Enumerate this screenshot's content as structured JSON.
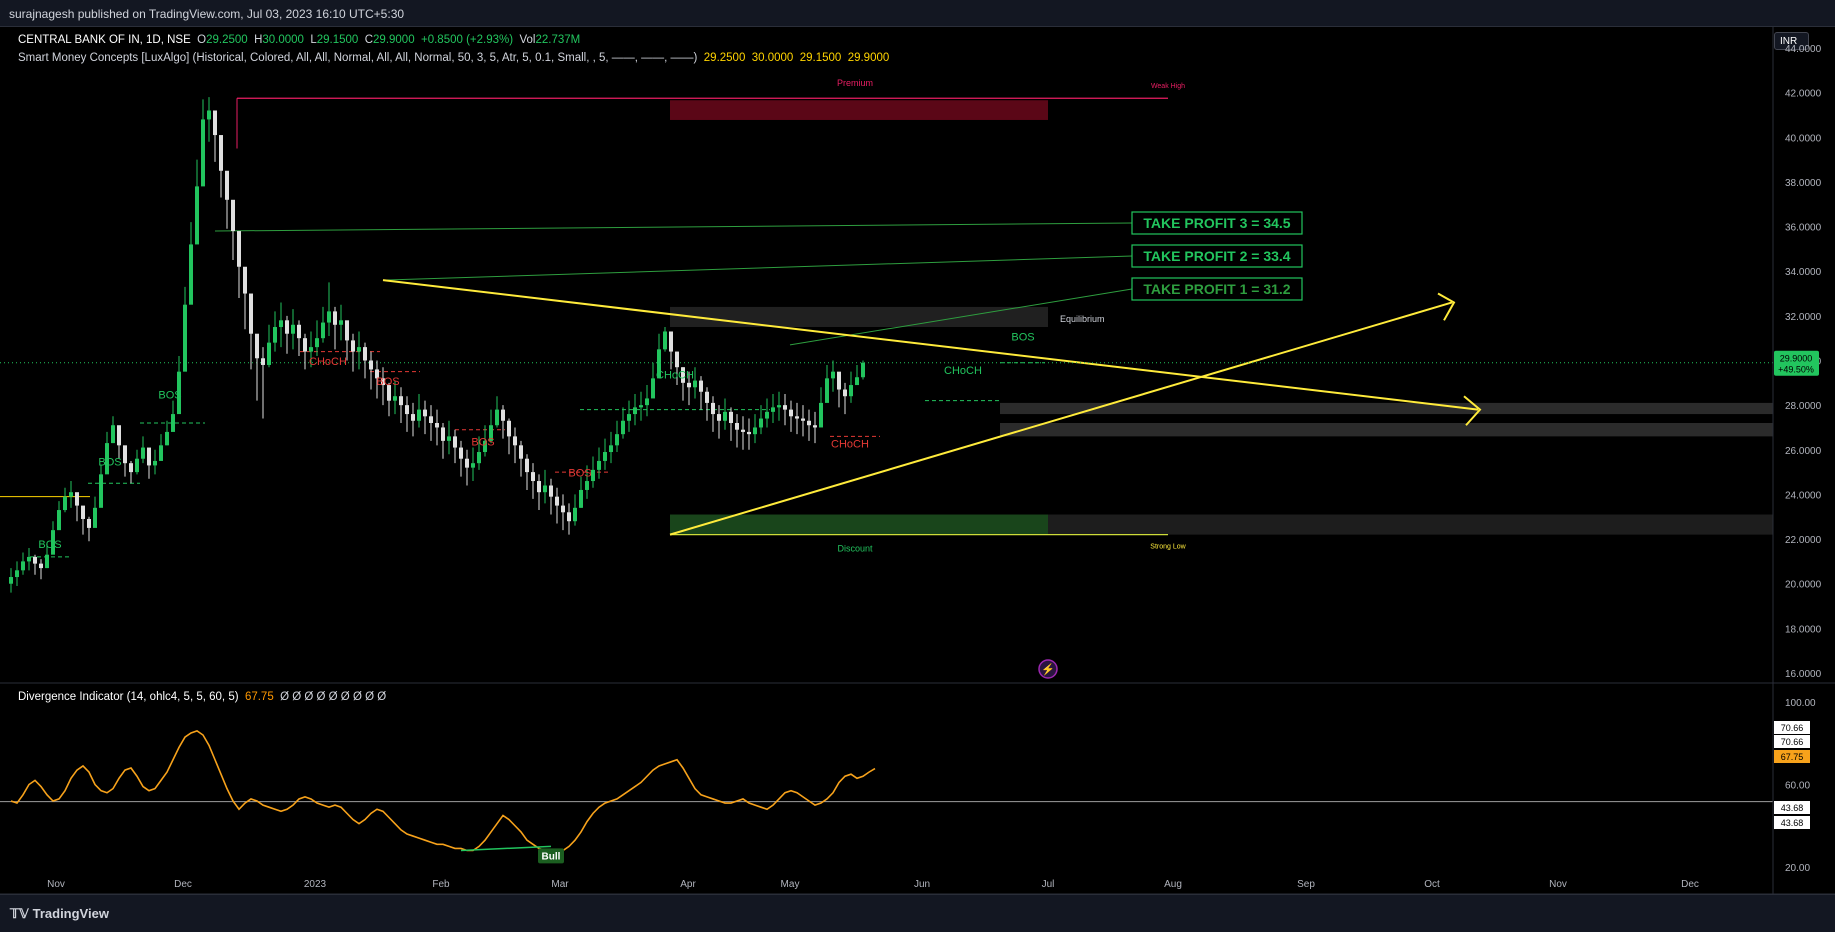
{
  "header": {
    "publisher_line": "surajnagesh published on TradingView.com, Jul 03, 2023 16:10 UTC+5:30"
  },
  "footer": {
    "brand": "TradingView"
  },
  "currency_button": "INR",
  "legend": {
    "symbol": "CENTRAL BANK OF IN, 1D, NSE",
    "o_label": "O",
    "o_value": "29.2500",
    "h_label": "H",
    "h_value": "30.0000",
    "l_label": "L",
    "l_value": "29.1500",
    "c_label": "C",
    "c_value": "29.9000",
    "change": "+0.8500 (+2.93%)",
    "vol_label": "Vol",
    "vol_value": "22.737M",
    "indicator": "Smart Money Concepts [LuxAlgo] (Historical, Colored, All, All, Normal, All, All, Normal, 50, 3, 5, Atr, 5, 0.1, Small, , 5, ——, ——, ——)",
    "indicator_values": [
      "29.2500",
      "30.0000",
      "29.1500",
      "29.9000"
    ]
  },
  "osc_legend": {
    "name": "Divergence Indicator (14, ohlc4, 5, 5, 60, 5)",
    "value": "67.75",
    "empties": "Ø Ø Ø Ø Ø Ø Ø Ø Ø"
  },
  "colors": {
    "up": "#22c55e",
    "down": "#e0e0e0",
    "bos_green": "#22c55e",
    "bos_red": "#e53935",
    "trend_yellow": "#ffeb3b",
    "osc_line": "#f7a21b",
    "premium": "#e91e63"
  },
  "chart_data": [
    {
      "type": "candlestick",
      "title": "CENTRAL BANK OF IN, 1D, NSE",
      "y_ticks": [
        "16.0000",
        "18.0000",
        "20.0000",
        "22.0000",
        "24.0000",
        "26.0000",
        "28.0000",
        "30.0000",
        "32.0000",
        "34.0000",
        "36.0000",
        "38.0000",
        "40.0000",
        "42.0000",
        "44.0000"
      ],
      "ylim": [
        15.3,
        45.2
      ],
      "x_ticks": [
        "Nov",
        "Dec",
        "2023",
        "Feb",
        "Mar",
        "Apr",
        "May",
        "Jun",
        "Jul",
        "Aug",
        "Sep",
        "Oct",
        "Nov",
        "Dec"
      ],
      "last_price": "29.9000",
      "last_change_pct": "+49.50%",
      "zones": {
        "premium_label": "Premium",
        "weak_high_label": "Weak High",
        "equilibrium_label": "Equilibrium",
        "discount_label": "Discount",
        "strong_low_label": "Strong Low",
        "weak_high": 41.75,
        "strong_low": 22.2
      },
      "take_profits": [
        "TAKE PROFIT 3 = 34.5",
        "TAKE PROFIT 2 = 33.4",
        "TAKE PROFIT 1 = 31.2"
      ],
      "structure_labels": [
        {
          "text": "BOS",
          "color": "green"
        },
        {
          "text": "BOS",
          "color": "green"
        },
        {
          "text": "BOS",
          "color": "green"
        },
        {
          "text": "CHoCH",
          "color": "red"
        },
        {
          "text": "BOS",
          "color": "red"
        },
        {
          "text": "BOS",
          "color": "red"
        },
        {
          "text": "BOS",
          "color": "red"
        },
        {
          "text": "CHoCH",
          "color": "green"
        },
        {
          "text": "CHoCH",
          "color": "red"
        },
        {
          "text": "CHoCH",
          "color": "green"
        },
        {
          "text": "BOS",
          "color": "green"
        }
      ],
      "close_series": [
        20.3,
        20.6,
        21.0,
        21.2,
        20.9,
        20.7,
        21.3,
        22.4,
        23.3,
        23.9,
        24.1,
        23.5,
        22.9,
        22.5,
        23.4,
        24.9,
        26.3,
        27.1,
        26.2,
        25.4,
        25.0,
        25.6,
        26.1,
        25.3,
        25.5,
        26.2,
        26.8,
        27.6,
        29.5,
        32.5,
        35.2,
        37.8,
        40.8,
        41.2,
        40.1,
        38.5,
        37.2,
        35.8,
        34.2,
        33.0,
        31.2,
        30.1,
        29.8,
        30.8,
        31.5,
        31.8,
        31.2,
        31.6,
        31.0,
        30.4,
        30.6,
        31.0,
        31.7,
        32.2,
        31.6,
        31.8,
        30.9,
        30.4,
        30.6,
        30.0,
        29.6,
        29.2,
        28.9,
        28.2,
        28.4,
        28.0,
        27.6,
        27.3,
        27.8,
        27.5,
        27.2,
        27.0,
        26.4,
        26.6,
        26.1,
        25.6,
        25.2,
        25.4,
        25.9,
        26.4,
        27.1,
        27.8,
        27.3,
        26.6,
        26.2,
        25.6,
        25.0,
        24.6,
        24.1,
        24.4,
        23.9,
        23.5,
        23.2,
        22.8,
        23.4,
        24.2,
        24.6,
        25.1,
        25.5,
        25.9,
        26.2,
        26.7,
        27.3,
        27.6,
        27.9,
        28.0,
        28.3,
        29.2,
        30.5,
        31.3,
        30.4,
        29.7,
        29.0,
        28.8,
        29.1,
        28.6,
        28.1,
        27.6,
        27.3,
        27.7,
        27.2,
        26.9,
        26.8,
        26.7,
        27.0,
        27.4,
        27.7,
        27.9,
        28.0,
        27.8,
        27.5,
        27.4,
        27.3,
        27.1,
        27.0,
        28.1,
        29.2,
        29.5,
        28.7,
        28.4,
        28.9,
        29.25,
        29.9
      ],
      "high_series": [
        20.7,
        21.0,
        21.4,
        21.6,
        21.3,
        21.1,
        21.8,
        22.8,
        23.7,
        24.3,
        24.6,
        24.0,
        23.4,
        23.0,
        23.9,
        25.3,
        26.8,
        27.5,
        26.7,
        25.9,
        25.5,
        26.0,
        26.6,
        25.8,
        26.0,
        26.7,
        27.3,
        28.2,
        30.2,
        33.3,
        36.2,
        39.0,
        41.7,
        41.8,
        41.0,
        39.4,
        38.0,
        36.6,
        35.0,
        33.8,
        32.0,
        30.9,
        30.6,
        31.6,
        32.2,
        32.6,
        32.0,
        32.3,
        31.8,
        31.2,
        31.3,
        31.8,
        32.4,
        33.5,
        32.4,
        32.5,
        31.7,
        31.2,
        31.3,
        30.8,
        30.4,
        30.0,
        29.7,
        29.0,
        29.1,
        28.8,
        28.4,
        28.1,
        28.5,
        28.2,
        28.0,
        27.8,
        27.2,
        27.3,
        26.9,
        26.4,
        26.0,
        26.1,
        26.6,
        27.1,
        27.8,
        28.4,
        28.0,
        27.4,
        27.0,
        26.4,
        25.8,
        25.4,
        24.9,
        25.1,
        24.7,
        24.3,
        24.0,
        23.6,
        24.0,
        24.8,
        25.3,
        25.7,
        26.1,
        26.5,
        26.8,
        27.3,
        27.9,
        28.2,
        28.5,
        28.6,
        28.9,
        29.9,
        31.2,
        31.5,
        31.0,
        30.4,
        29.7,
        29.5,
        29.7,
        29.3,
        28.8,
        28.4,
        28.0,
        28.3,
        27.9,
        27.6,
        27.5,
        27.4,
        27.6,
        28.0,
        28.3,
        28.5,
        28.6,
        28.5,
        28.2,
        28.1,
        28.0,
        27.8,
        27.7,
        28.8,
        29.8,
        30.0,
        29.4,
        29.0,
        29.5,
        29.8,
        30.0
      ],
      "low_series": [
        19.6,
        19.9,
        20.4,
        20.6,
        20.4,
        20.2,
        20.7,
        21.7,
        22.6,
        23.2,
        23.4,
        22.8,
        22.2,
        21.9,
        22.7,
        24.2,
        25.6,
        26.3,
        25.6,
        24.8,
        24.5,
        24.9,
        25.4,
        24.7,
        24.9,
        25.6,
        26.2,
        26.9,
        28.6,
        31.1,
        33.5,
        36.1,
        38.9,
        39.8,
        38.9,
        37.3,
        35.9,
        34.5,
        32.8,
        31.4,
        29.6,
        28.2,
        27.4,
        29.7,
        30.4,
        30.6,
        30.3,
        30.5,
        30.2,
        29.6,
        29.7,
        30.2,
        30.8,
        31.1,
        30.5,
        30.9,
        30.0,
        29.5,
        29.6,
        29.2,
        28.7,
        28.3,
        28.0,
        27.5,
        27.6,
        27.2,
        26.8,
        26.6,
        27.0,
        26.7,
        26.4,
        26.2,
        25.6,
        25.8,
        25.4,
        24.8,
        24.4,
        24.6,
        25.1,
        25.7,
        26.3,
        27.0,
        26.5,
        25.8,
        25.4,
        24.8,
        24.2,
        23.8,
        23.3,
        23.6,
        23.1,
        22.7,
        22.4,
        22.2,
        22.6,
        23.4,
        23.8,
        24.3,
        24.7,
        25.1,
        25.4,
        25.9,
        26.5,
        26.8,
        27.1,
        27.3,
        27.5,
        28.4,
        29.6,
        30.4,
        29.6,
        28.9,
        28.2,
        28.0,
        28.3,
        27.8,
        27.3,
        26.8,
        26.5,
        26.9,
        26.4,
        26.1,
        26.0,
        26.0,
        26.3,
        26.7,
        27.0,
        27.2,
        27.3,
        27.1,
        26.8,
        26.7,
        26.6,
        26.4,
        26.3,
        27.2,
        28.3,
        28.6,
        27.9,
        27.6,
        28.1,
        29.15,
        29.15
      ]
    },
    {
      "type": "line",
      "title": "Divergence Indicator (14, ohlc4, 5, 5, 60, 5)",
      "y_ticks": [
        "20.00",
        "60.00",
        "100.00"
      ],
      "ylim": [
        8.4,
        102.2
      ],
      "reference_line": 51.7,
      "value_labels": [
        "70.66",
        "70.66",
        "67.75",
        "43.68",
        "43.68"
      ],
      "divergence_label": "Bull",
      "values": [
        52,
        51,
        55,
        60,
        62,
        59,
        55,
        52,
        53,
        57,
        63,
        67,
        69,
        66,
        60,
        57,
        56,
        58,
        63,
        67,
        68,
        64,
        59,
        57,
        58,
        62,
        66,
        72,
        78,
        83,
        85,
        86,
        84,
        79,
        72,
        65,
        58,
        52,
        48,
        51,
        53,
        52,
        50,
        49,
        48,
        47,
        48,
        50,
        53,
        54,
        53,
        51,
        50,
        49,
        50,
        49,
        46,
        43,
        41,
        43,
        46,
        48,
        47,
        44,
        41,
        38,
        36,
        35,
        34,
        33,
        32,
        31,
        31,
        30,
        29,
        29,
        28,
        28,
        30,
        33,
        37,
        41,
        45,
        43,
        40,
        37,
        33,
        31,
        29,
        28,
        27,
        27,
        28,
        30,
        33,
        37,
        42,
        46,
        49,
        51,
        52,
        53,
        55,
        57,
        59,
        61,
        64,
        67,
        69,
        70,
        71,
        72,
        68,
        63,
        58,
        55,
        54,
        53,
        52,
        51,
        51,
        52,
        53,
        51,
        50,
        49,
        48,
        50,
        53,
        56,
        57,
        56,
        54,
        52,
        50,
        51,
        53,
        56,
        61,
        64,
        65,
        63,
        64,
        66,
        67.75
      ]
    }
  ]
}
